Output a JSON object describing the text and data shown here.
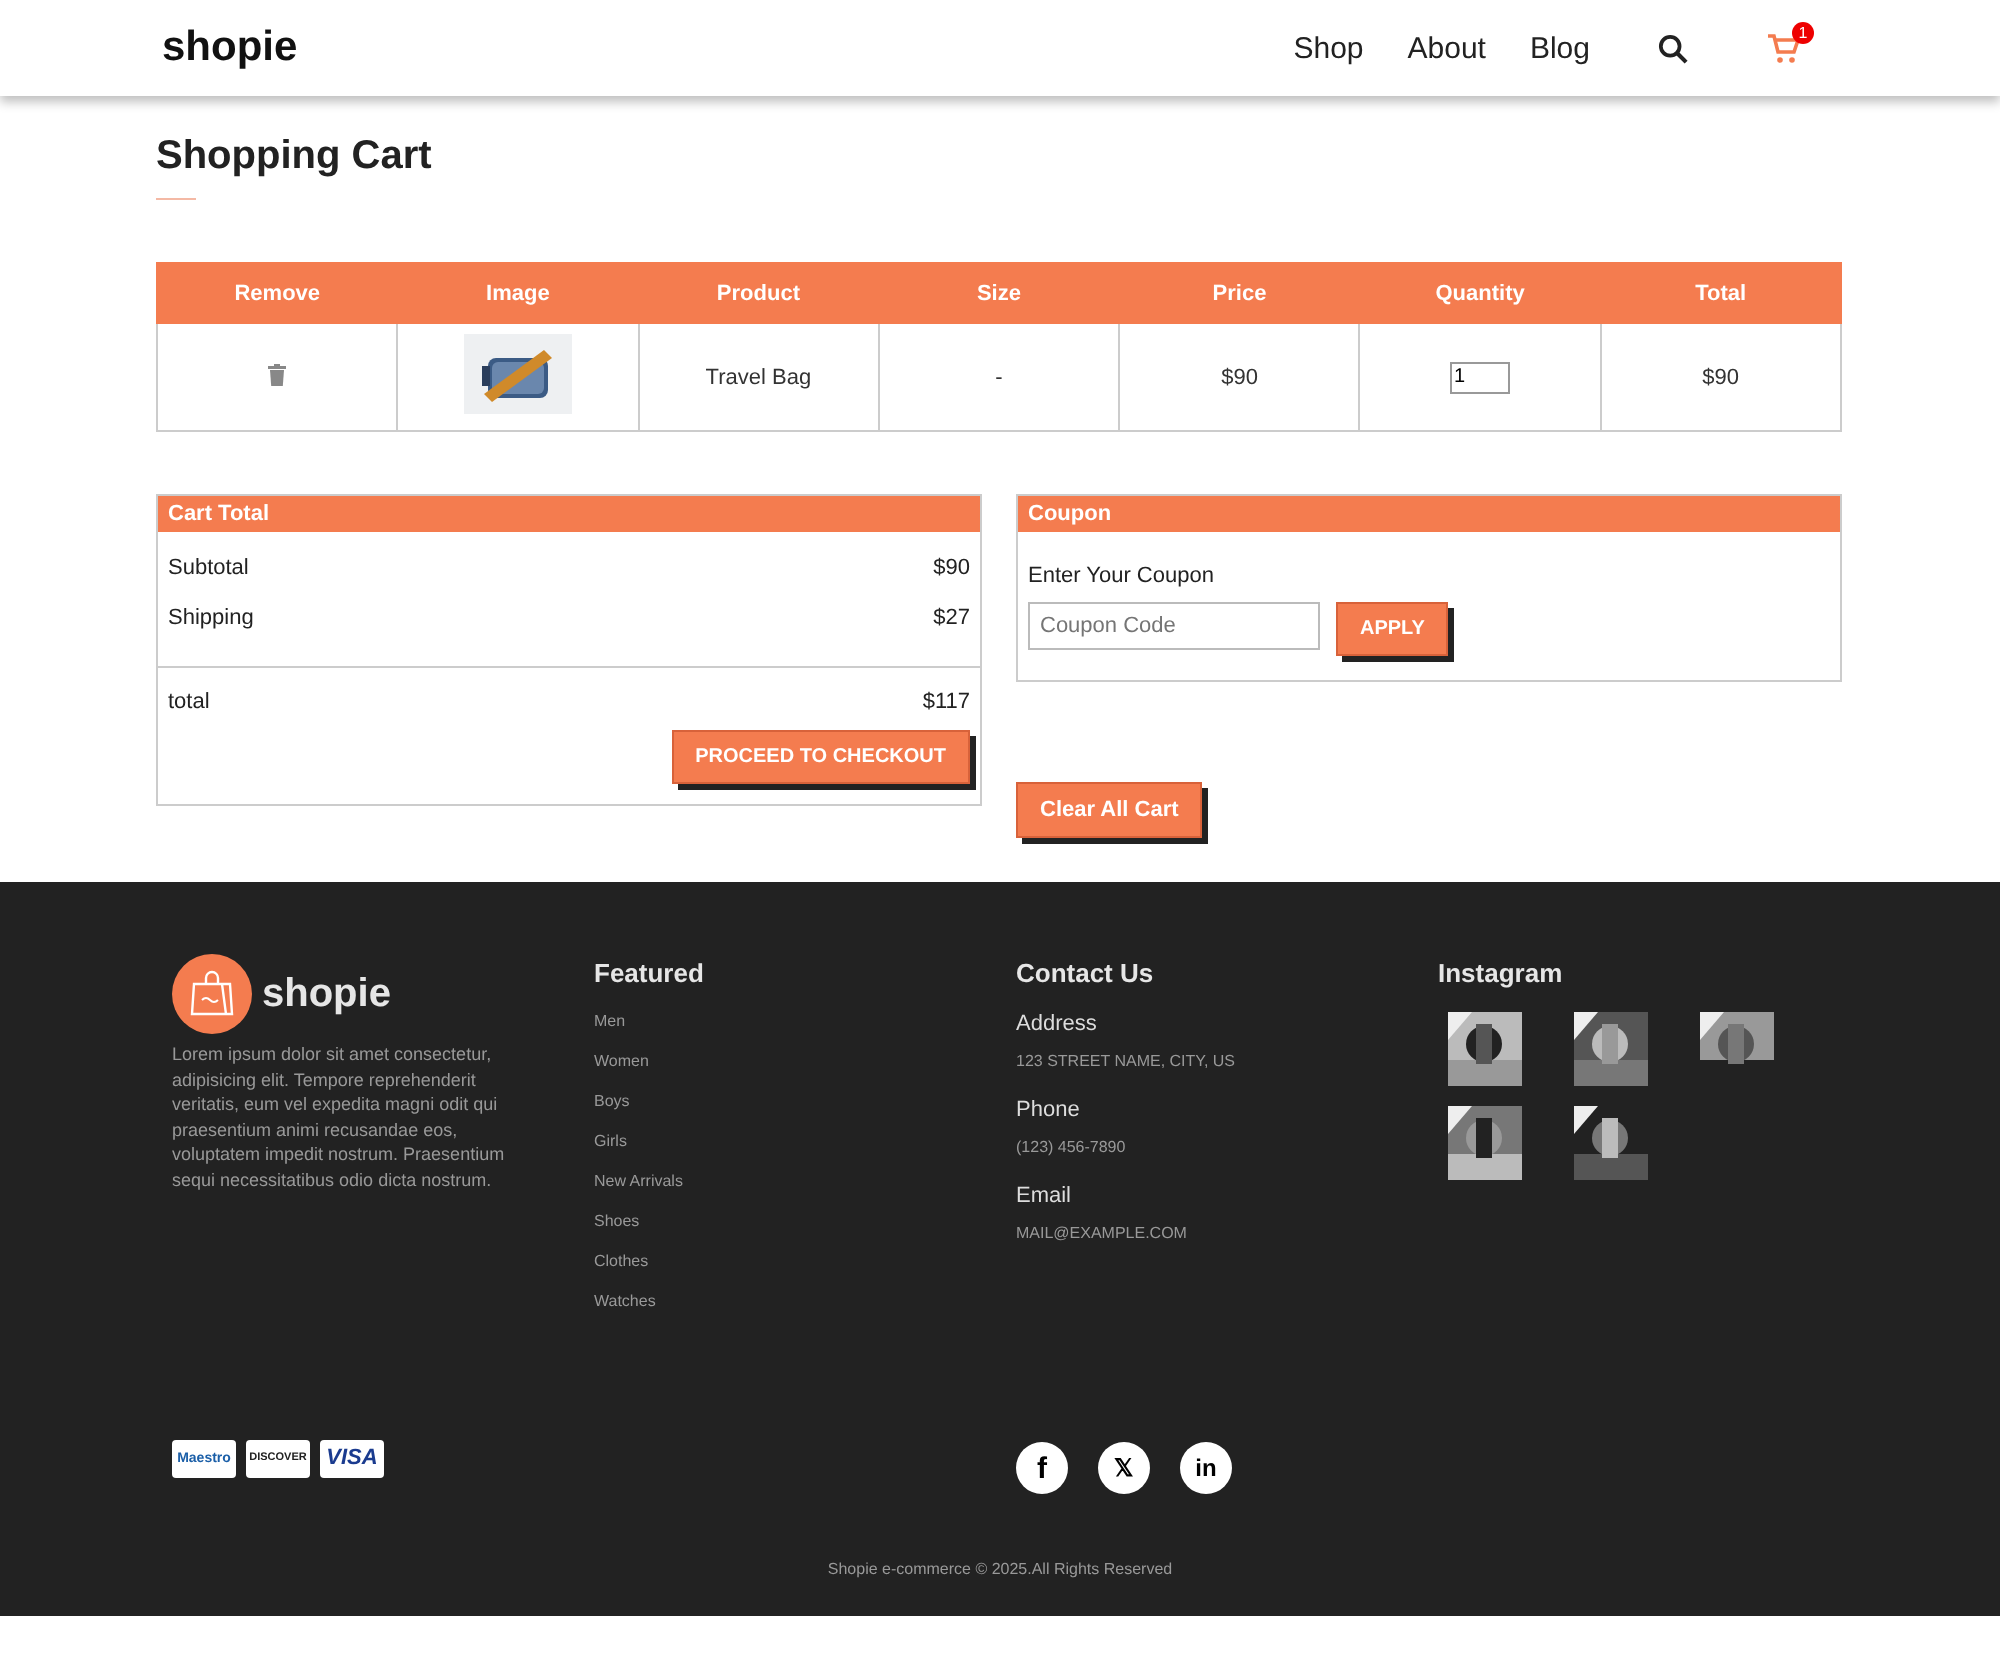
{
  "header": {
    "logo": "shopie",
    "nav": [
      {
        "label": "Shop"
      },
      {
        "label": "About"
      },
      {
        "label": "Blog"
      }
    ],
    "cart_count": "1"
  },
  "page_title": "Shopping Cart",
  "table": {
    "columns": [
      "Remove",
      "Image",
      "Product",
      "Size",
      "Price",
      "Quantity",
      "Total"
    ],
    "rows": [
      {
        "product": "Travel Bag",
        "size": "-",
        "price": "$90",
        "quantity": "1",
        "total": "$90"
      }
    ]
  },
  "cart_total": {
    "title": "Cart Total",
    "lines": [
      {
        "label": "Subtotal",
        "value": "$90"
      },
      {
        "label": "Shipping",
        "value": "$27"
      }
    ],
    "total": {
      "label": "total",
      "value": "$117"
    },
    "checkout": "PROCEED TO CHECKOUT"
  },
  "coupon": {
    "title": "Coupon",
    "label": "Enter Your Coupon",
    "placeholder": "Coupon Code",
    "apply": "APPLY"
  },
  "clear_button": "Clear All Cart",
  "footer": {
    "logo": "shopie",
    "about": "Lorem ipsum dolor sit amet consectetur, adipisicing elit. Tempore reprehenderit veritatis, eum vel expedita magni odit qui praesentium animi recusandae eos, voluptatem impedit nostrum. Praesentium sequi necessitatibus odio dicta nostrum.",
    "featured": {
      "title": "Featured",
      "links": [
        "Men",
        "Women",
        "Boys",
        "Girls",
        "New Arrivals",
        "Shoes",
        "Clothes",
        "Watches"
      ]
    },
    "contact": {
      "title": "Contact Us",
      "items": [
        {
          "label": "Address",
          "value": "123 STREET NAME, CITY, US"
        },
        {
          "label": "Phone",
          "value": "(123) 456-7890"
        },
        {
          "label": "Email",
          "value": "MAIL@EXAMPLE.COM"
        }
      ]
    },
    "instagram": {
      "title": "Instagram"
    },
    "payment_cards": [
      {
        "kind": "maestro",
        "label": "Maestro"
      },
      {
        "kind": "discover",
        "label": "DISCOVER"
      },
      {
        "kind": "visa",
        "label": "VISA"
      }
    ],
    "social": [
      {
        "kind": "facebook",
        "glyph": "f"
      },
      {
        "kind": "x",
        "glyph": "𝕏"
      },
      {
        "kind": "linkedin",
        "glyph": "in"
      }
    ],
    "copyright": "Shopie e-commerce © 2025.All Rights Reserved"
  }
}
